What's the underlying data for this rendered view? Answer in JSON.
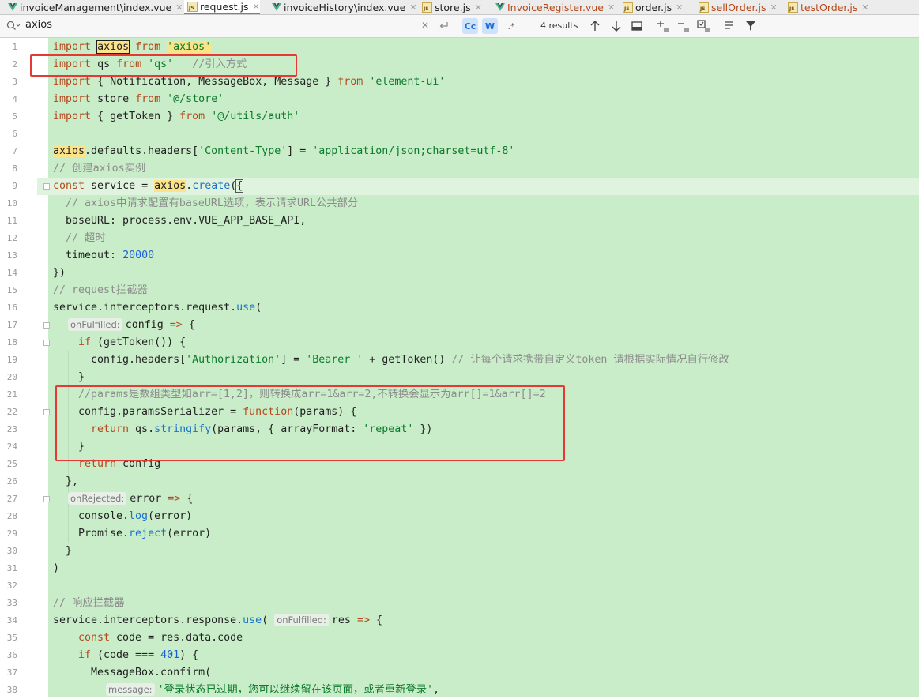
{
  "tabs": [
    {
      "label": "invoiceManagement\\index.vue",
      "icon": "vue-icon",
      "active": false
    },
    {
      "label": "request.js",
      "icon": "js-icon",
      "active": true
    },
    {
      "label": "invoiceHistory\\index.vue",
      "icon": "vue-icon",
      "active": false
    },
    {
      "label": "store.js",
      "icon": "js-icon",
      "active": false
    },
    {
      "label": "InvoiceRegister.vue",
      "icon": "vue-icon",
      "active": false
    },
    {
      "label": "order.js",
      "icon": "js-icon",
      "active": false
    },
    {
      "label": "sellOrder.js",
      "icon": "js-icon",
      "active": false
    },
    {
      "label": "testOrder.js",
      "icon": "js-icon",
      "active": false
    }
  ],
  "search": {
    "query": "axios",
    "results": "4 results",
    "match_case_label": "Cc",
    "words_label": "W",
    "regex_label": ".*"
  },
  "colors": {
    "code_background": "#c9ecc9",
    "annotation_box": "#e53935",
    "active_tab_accent": "#4a88e0"
  },
  "lines": [
    {
      "n": "1"
    },
    {
      "n": "2"
    },
    {
      "n": "3"
    },
    {
      "n": "4"
    },
    {
      "n": "5"
    },
    {
      "n": "6"
    },
    {
      "n": "7"
    },
    {
      "n": "8"
    },
    {
      "n": "9"
    },
    {
      "n": "10"
    },
    {
      "n": "11"
    },
    {
      "n": "12"
    },
    {
      "n": "13"
    },
    {
      "n": "14"
    },
    {
      "n": "15"
    },
    {
      "n": "16"
    },
    {
      "n": "17"
    },
    {
      "n": "18"
    },
    {
      "n": "19"
    },
    {
      "n": "20"
    },
    {
      "n": "21"
    },
    {
      "n": "22"
    },
    {
      "n": "23"
    },
    {
      "n": "24"
    },
    {
      "n": "25"
    },
    {
      "n": "26"
    },
    {
      "n": "27"
    },
    {
      "n": "28"
    },
    {
      "n": "29"
    },
    {
      "n": "30"
    },
    {
      "n": "31"
    },
    {
      "n": "32"
    },
    {
      "n": "33"
    },
    {
      "n": "34"
    },
    {
      "n": "35"
    },
    {
      "n": "36"
    },
    {
      "n": "37"
    },
    {
      "n": "38"
    }
  ],
  "code": {
    "l1": {
      "a": "import",
      "b": "axios",
      "c": "from",
      "d": "'axios'"
    },
    "l2": {
      "a": "import",
      "b": "qs",
      "c": "from",
      "d": "'qs'",
      "e": "//引入方式"
    },
    "l3": {
      "a": "import",
      "b": "{ Notification, MessageBox, Message }",
      "c": "from",
      "d": "'element-ui'"
    },
    "l4": {
      "a": "import",
      "b": "store",
      "c": "from",
      "d": "'@/store'"
    },
    "l5": {
      "a": "import",
      "b": "{ getToken }",
      "c": "from",
      "d": "'@/utils/auth'"
    },
    "l7": {
      "a": "axios",
      "b": ".defaults.headers[",
      "c": "'Content-Type'",
      "d": "] = ",
      "e": "'application/json;charset=utf-8'"
    },
    "l8": {
      "a": "// 创建axios实例"
    },
    "l9": {
      "a": "const",
      "b": "service",
      "c": "=",
      "d": "axios",
      "e": ".",
      "f": "create",
      "g": "(",
      "h": "{"
    },
    "l10": {
      "a": "// axios中请求配置有baseURL选项，表示请求URL公共部分"
    },
    "l11": {
      "a": "baseURL",
      "b": ": process.env.VUE_APP_BASE_API,"
    },
    "l12": {
      "a": "// 超时"
    },
    "l13": {
      "a": "timeout",
      "b": ": ",
      "c": "20000"
    },
    "l14": {
      "a": "})"
    },
    "l15": {
      "a": "// request拦截器"
    },
    "l16": {
      "a": "service.interceptors.request.",
      "b": "use",
      "c": "("
    },
    "l17": {
      "hint": "onFulfilled:",
      "a": "config",
      "b": "=>",
      "c": "{"
    },
    "l18": {
      "a": "if",
      "b": "(getToken()) {"
    },
    "l19": {
      "a": "config.headers[",
      "b": "'Authorization'",
      "c": "] = ",
      "d": "'Bearer '",
      "e": " + getToken() ",
      "f": "// 让每个请求携带自定义token 请根据实际情况自行修改"
    },
    "l20": {
      "a": "}"
    },
    "l21": {
      "a": "//params是数组类型如arr=[1,2]，则转换成arr=1&arr=2,不转换会显示为arr[]=1&arr[]=2"
    },
    "l22": {
      "a": "config.paramsSerializer",
      "b": " = ",
      "c": "function",
      "d": "(params) {"
    },
    "l23": {
      "a": "return",
      "b": " qs.",
      "c": "stringify",
      "d": "(params, { ",
      "e": "arrayFormat",
      "f": ": ",
      "g": "'repeat'",
      "h": " })"
    },
    "l24": {
      "a": "}"
    },
    "l25": {
      "a": "return",
      "b": " config"
    },
    "l26": {
      "a": "},"
    },
    "l27": {
      "hint": "onRejected:",
      "a": "error",
      "b": "=>",
      "c": "{"
    },
    "l28": {
      "a": "console.",
      "b": "log",
      "c": "(error)"
    },
    "l29": {
      "a": "Promise.",
      "b": "reject",
      "c": "(error)"
    },
    "l30": {
      "a": "}"
    },
    "l31": {
      "a": ")"
    },
    "l33": {
      "a": "// 响应拦截器"
    },
    "l34": {
      "a": "service.interceptors.response.",
      "b": "use",
      "c": "(",
      "hint": "onFulfilled:",
      "d": "res",
      "e": "=>",
      "f": "{"
    },
    "l35": {
      "a": "const",
      "b": " code = res.data.code"
    },
    "l36": {
      "a": "if",
      "b": " (code === ",
      "c": "401",
      "d": ") {"
    },
    "l37": {
      "a": "MessageBox.confirm("
    },
    "l38": {
      "hint": "message:",
      "a": "'登录状态已过期，您可以继续留在该页面，或者重新登录'",
      "b": ","
    }
  }
}
